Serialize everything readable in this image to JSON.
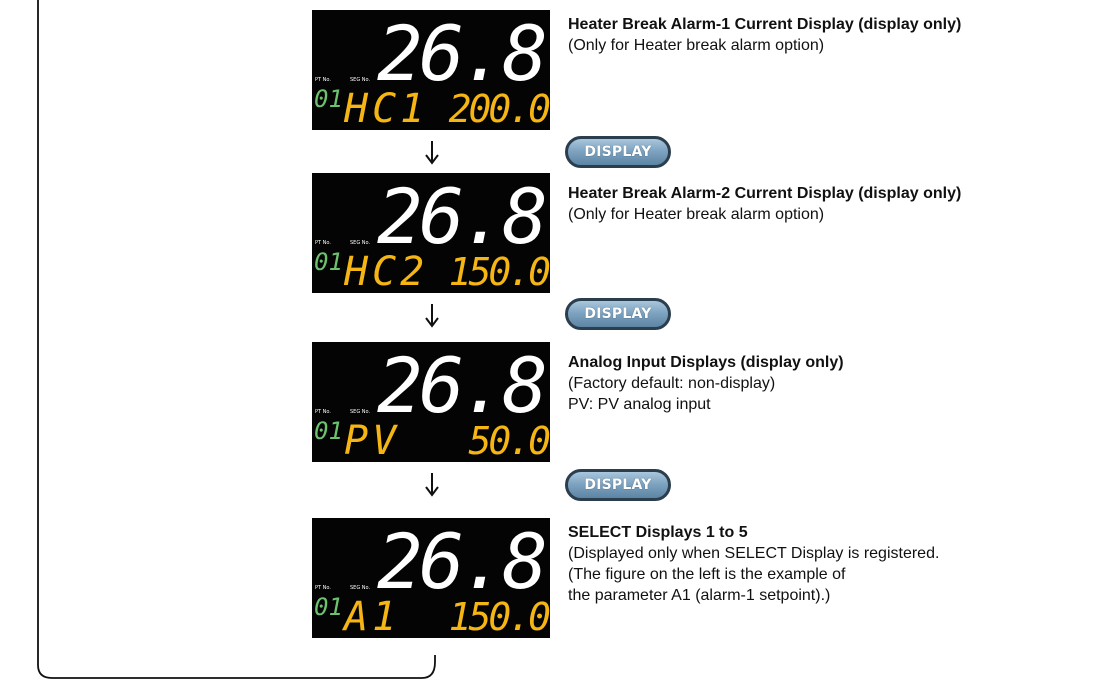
{
  "colors": {
    "pv": "#ffffff",
    "sub": "#f5b614",
    "pt": "#6cc26f",
    "button": "#7fa4c1"
  },
  "nav_button_label": "DISPLAY",
  "screens": [
    {
      "pv": "26.8",
      "pt_label": "PT No.",
      "seg_label": "SEG No.",
      "pt_value": "01",
      "param": "HC1",
      "value": "200.0",
      "title": "Heater Break Alarm-1 Current Display (display only)",
      "lines": [
        "(Only for Heater break alarm option)"
      ]
    },
    {
      "pv": "26.8",
      "pt_label": "PT No.",
      "seg_label": "SEG No.",
      "pt_value": "01",
      "param": "HC2",
      "value": "150.0",
      "title": "Heater Break Alarm-2 Current Display (display only)",
      "lines": [
        "(Only for Heater break alarm option)"
      ]
    },
    {
      "pv": "26.8",
      "pt_label": "PT No.",
      "seg_label": "SEG No.",
      "pt_value": "01",
      "param": "PV",
      "value": "50.0",
      "title": "Analog Input Displays (display only)",
      "lines": [
        "(Factory default: non-display)",
        "PV: PV analog input"
      ]
    },
    {
      "pv": "26.8",
      "pt_label": "PT No.",
      "seg_label": "SEG No.",
      "pt_value": "01",
      "param": "A1",
      "value": "150.0",
      "title": "SELECT Displays 1 to 5",
      "lines": [
        "(Displayed only when SELECT Display is registered.",
        "(The figure on the left is the example of",
        "the parameter A1 (alarm-1 setpoint).)"
      ]
    }
  ]
}
